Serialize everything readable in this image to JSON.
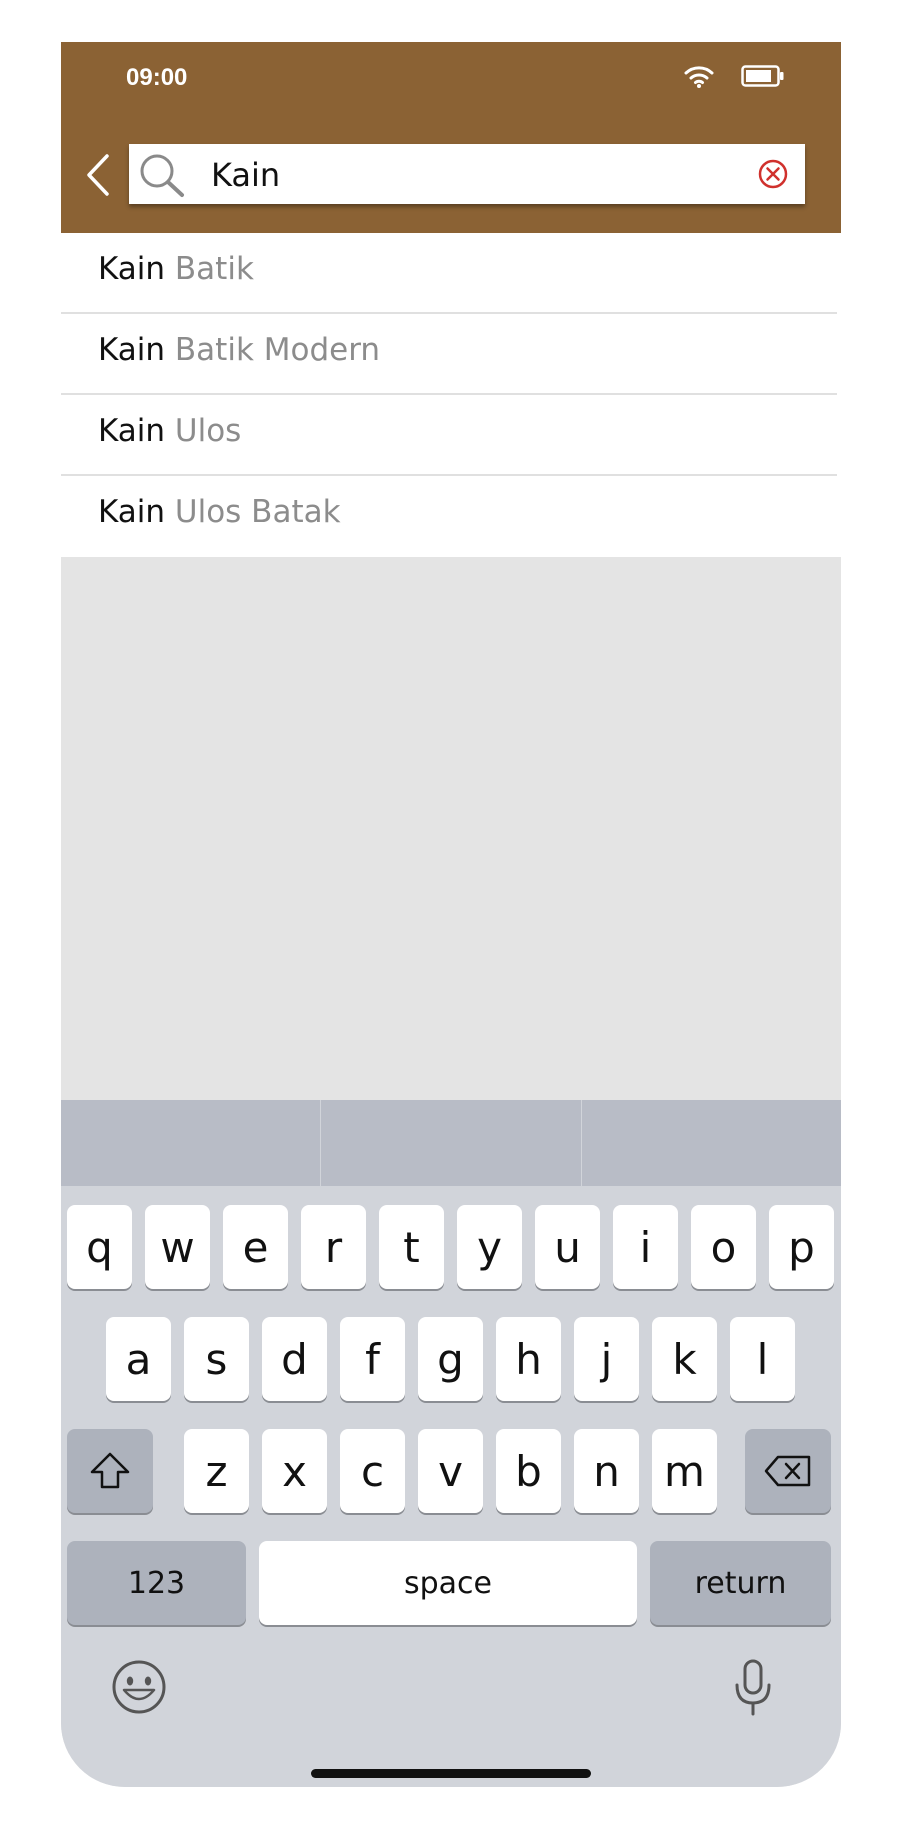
{
  "status_bar": {
    "time": "09:00"
  },
  "search": {
    "value": "Kain"
  },
  "suggestions": [
    {
      "match": "Kain",
      "rest": "Batik"
    },
    {
      "match": "Kain",
      "rest": "Batik Modern"
    },
    {
      "match": "Kain",
      "rest": "Ulos"
    },
    {
      "match": "Kain",
      "rest": "Ulos Batak"
    }
  ],
  "keyboard": {
    "row1": [
      "q",
      "w",
      "e",
      "r",
      "t",
      "y",
      "u",
      "i",
      "o",
      "p"
    ],
    "row2": [
      "a",
      "s",
      "d",
      "f",
      "g",
      "h",
      "j",
      "k",
      "l"
    ],
    "row3": [
      "z",
      "x",
      "c",
      "v",
      "b",
      "n",
      "m"
    ],
    "numbers_label": "123",
    "space_label": "space",
    "return_label": "return"
  },
  "colors": {
    "header": "#8b6234",
    "clear_icon": "#d0312d"
  }
}
